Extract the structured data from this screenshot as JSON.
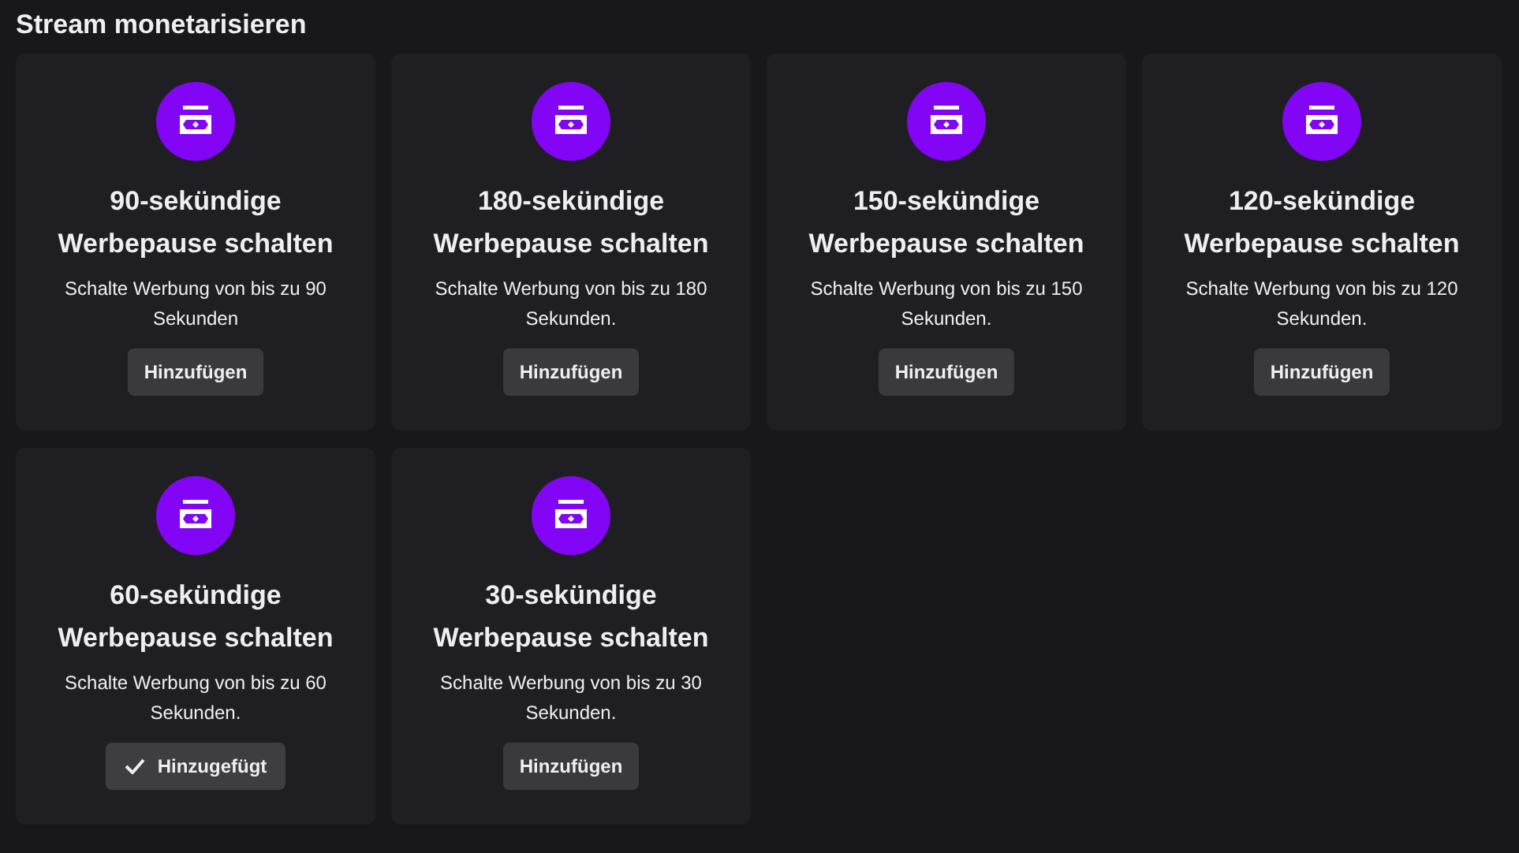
{
  "page_title": "Stream monetarisieren",
  "cards": [
    {
      "title": "90-sekündige Werbepause schalten",
      "description": "Schalte Werbung von bis zu 90 Sekunden",
      "button": "Hinzufügen",
      "added": false
    },
    {
      "title": "180-sekündige Werbepause schalten",
      "description": "Schalte Werbung von bis zu 180 Sekunden.",
      "button": "Hinzufügen",
      "added": false
    },
    {
      "title": "150-sekündige Werbepause schalten",
      "description": "Schalte Werbung von bis zu 150 Sekunden.",
      "button": "Hinzufügen",
      "added": false
    },
    {
      "title": "120-sekündige Werbepause schalten",
      "description": "Schalte Werbung von bis zu 120 Sekunden.",
      "button": "Hinzufügen",
      "added": false
    },
    {
      "title": "60-sekündige Werbepause schalten",
      "description": "Schalte Werbung von bis zu 60 Sekunden.",
      "button": "Hinzugefügt",
      "added": true
    },
    {
      "title": "30-sekündige Werbepause schalten",
      "description": "Schalte Werbung von bis zu 30 Sekunden.",
      "button": "Hinzufügen",
      "added": false
    }
  ]
}
